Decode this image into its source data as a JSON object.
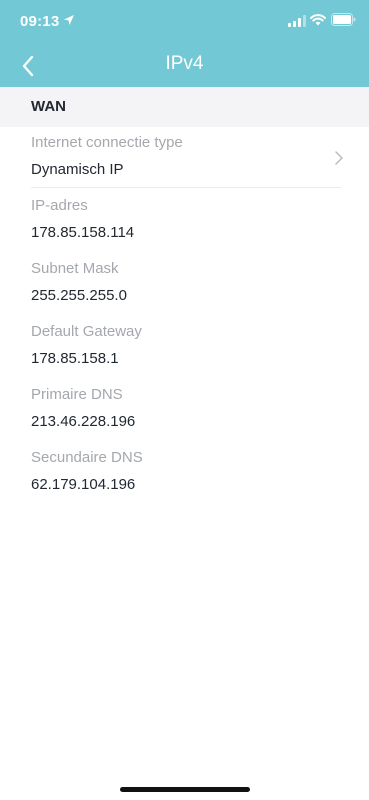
{
  "status_bar": {
    "time": "09:13",
    "icons": [
      "location-arrow-icon",
      "cellular-signal-icon",
      "wifi-icon",
      "battery-icon"
    ]
  },
  "nav": {
    "title": "IPv4",
    "back_icon": "chevron-left-icon"
  },
  "section": {
    "title": "WAN"
  },
  "fields": [
    {
      "label": "Internet connectie type",
      "value": "Dynamisch IP",
      "has_chevron": true
    },
    {
      "label": "IP-adres",
      "value": "178.85.158.114"
    },
    {
      "label": "Subnet Mask",
      "value": "255.255.255.0"
    },
    {
      "label": "Default Gateway",
      "value": "178.85.158.1"
    },
    {
      "label": "Primaire DNS",
      "value": "213.46.228.196"
    },
    {
      "label": "Secundaire DNS",
      "value": "62.179.104.196"
    }
  ],
  "colors": {
    "header_bg": "#72c8d5",
    "section_bg": "#f4f4f6",
    "label_text": "#a4a8ad",
    "value_text": "#222831"
  }
}
